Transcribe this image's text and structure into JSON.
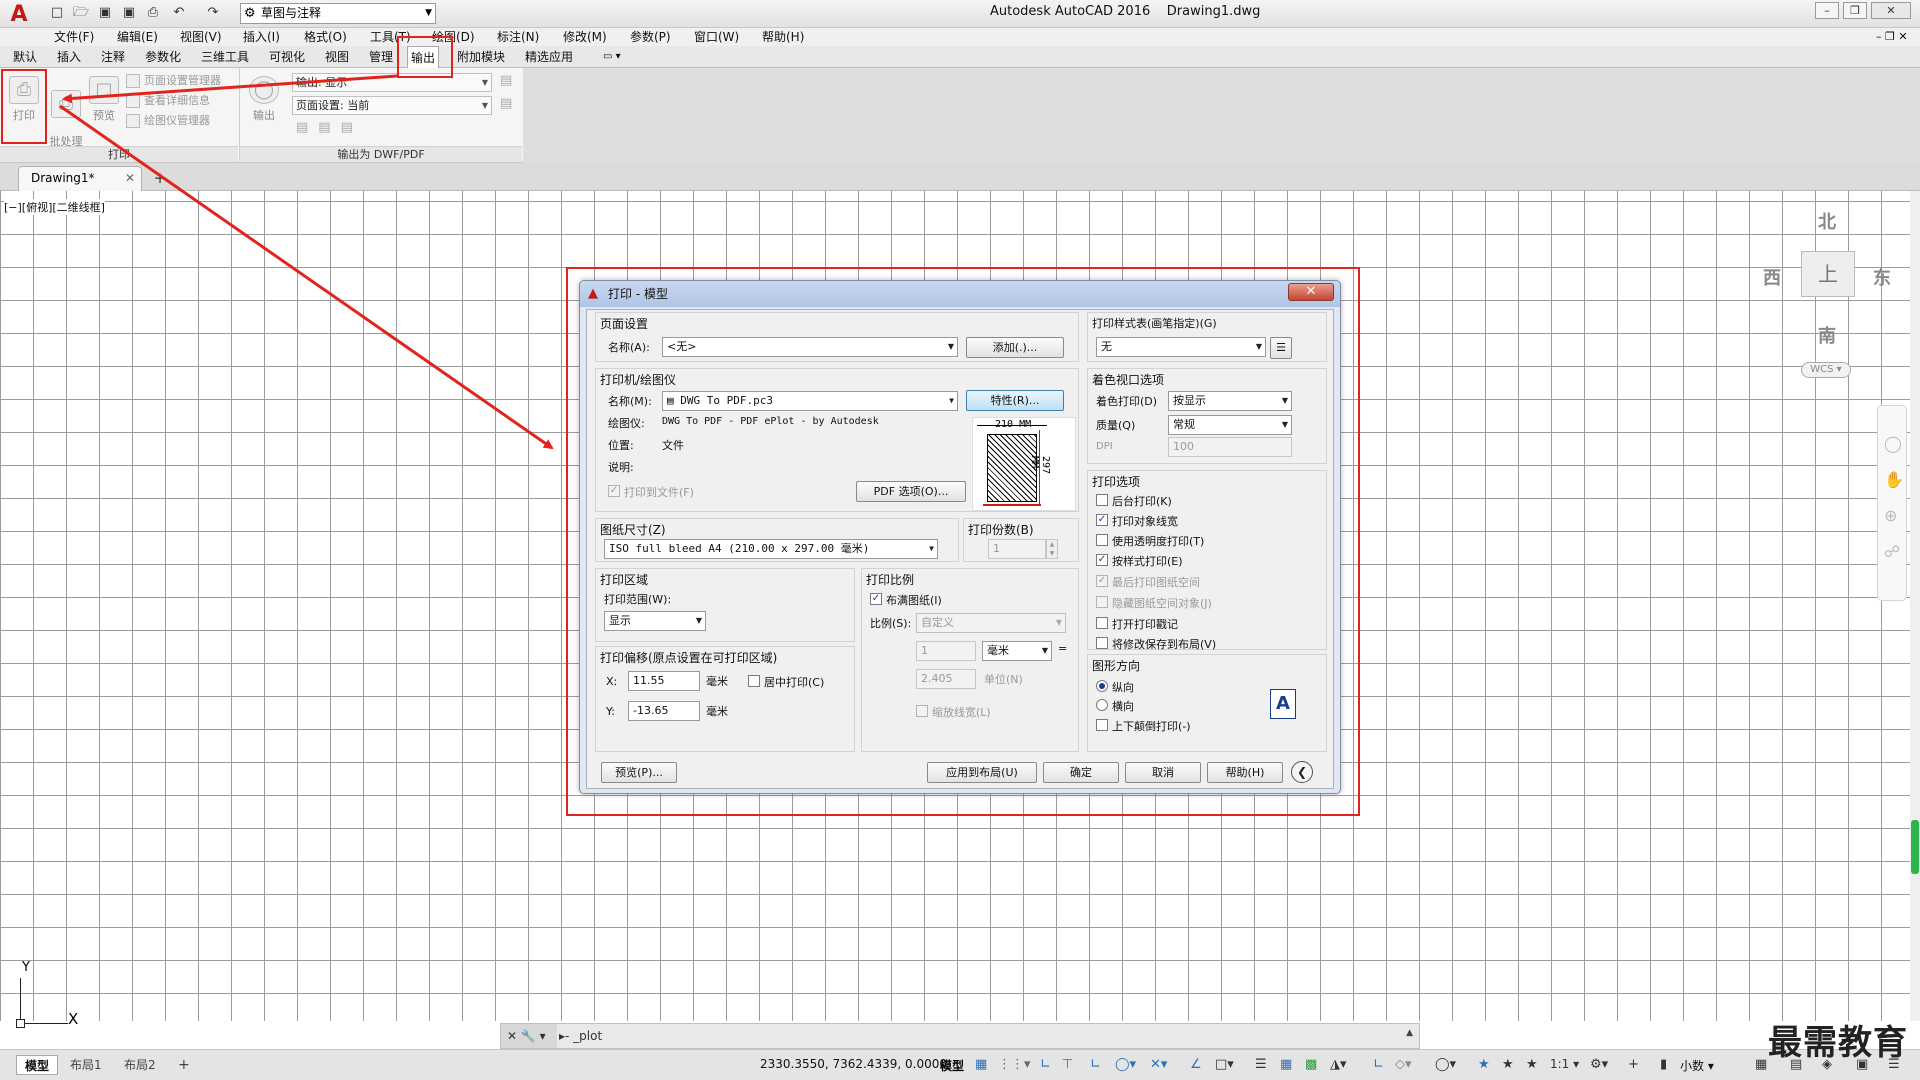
{
  "app": {
    "title": "Autodesk AutoCAD 2016",
    "file": "Drawing1.dwg",
    "logo_icon": "autocad-a-icon",
    "workspace": "草图与注释"
  },
  "menubar": [
    "文件(F)",
    "编辑(E)",
    "视图(V)",
    "插入(I)",
    "格式(O)",
    "工具(T)",
    "绘图(D)",
    "标注(N)",
    "修改(M)",
    "参数(P)",
    "窗口(W)",
    "帮助(H)"
  ],
  "ribbon_tabs": [
    "默认",
    "插入",
    "注释",
    "参数化",
    "三维工具",
    "可视化",
    "视图",
    "管理",
    "输出",
    "附加模块",
    "精选应用"
  ],
  "ribbon_active_tab": "输出",
  "ribbon": {
    "plot_label": "打印",
    "batch_label": "批处理\n打印",
    "preview_label": "预览",
    "page_setup_manager": "页面设置管理器",
    "view_details": "查看详细信息",
    "plotter_manager": "绘图仪管理器",
    "plot_panel": "打印",
    "export_label": "输出",
    "export_combo": "输出: 显示",
    "page_setup_combo": "页面设置: 当前",
    "export_panel": "输出为 DWF/PDF"
  },
  "doc_tab": "Drawing1*",
  "viewport_control": "[−][俯视][二维线框]",
  "viewcube": {
    "n": "北",
    "s": "南",
    "e": "东",
    "w": "西",
    "top": "上",
    "wcs": "WCS"
  },
  "ucs": {
    "x": "X",
    "y": "Y"
  },
  "command": {
    "prompt": "_plot"
  },
  "layout_tabs": [
    "模型",
    "布局1",
    "布局2"
  ],
  "status": {
    "coords": "2330.3550, 7362.4339, 0.0000",
    "mode": "模型",
    "scale": "1:1",
    "units": "小数"
  },
  "brand_watermark": "最需教育",
  "dialog": {
    "title": "打印 - 模型",
    "page_setup": {
      "group": "页面设置",
      "name_label": "名称(A):",
      "name_value": "<无>",
      "add_button": "添加(.)..."
    },
    "printer": {
      "group": "打印机/绘图仪",
      "name_label": "名称(M):",
      "name_value": "DWG To PDF.pc3",
      "properties_button": "特性(R)...",
      "plotter_label": "绘图仪:",
      "plotter_value": "DWG To PDF - PDF ePlot - by Autodesk",
      "location_label": "位置:",
      "location_value": "文件",
      "description_label": "说明:",
      "plot_to_file": "打印到文件(F)",
      "pdf_options_button": "PDF 选项(O)...",
      "paper_width": "210 MM",
      "paper_height": "297 MM"
    },
    "paper_size": {
      "group": "图纸尺寸(Z)",
      "value": "ISO full bleed A4 (210.00 x 297.00 毫米)"
    },
    "copies": {
      "group": "打印份数(B)",
      "value": "1"
    },
    "plot_area": {
      "group": "打印区域",
      "range_label": "打印范围(W):",
      "range_value": "显示"
    },
    "plot_scale": {
      "group": "打印比例",
      "fit_to_paper": "布满图纸(I)",
      "scale_label": "比例(S):",
      "scale_value": "自定义",
      "value1": "1",
      "unit": "毫米",
      "equals": "=",
      "value2": "2.405",
      "unit2": "单位(N)",
      "scale_lineweights": "缩放线宽(L)"
    },
    "plot_offset": {
      "group": "打印偏移(原点设置在可打印区域)",
      "x_label": "X:",
      "x_value": "11.55",
      "y_label": "Y:",
      "y_value": "-13.65",
      "unit": "毫米",
      "center": "居中打印(C)"
    },
    "style_table": {
      "group": "打印样式表(画笔指定)(G)",
      "value": "无"
    },
    "shaded_viewport": {
      "group": "着色视口选项",
      "shade_label": "着色打印(D)",
      "shade_value": "按显示",
      "quality_label": "质量(Q)",
      "quality_value": "常规",
      "dpi_label": "DPI",
      "dpi_value": "100"
    },
    "plot_options": {
      "group": "打印选项",
      "items": [
        {
          "label": "后台打印(K)",
          "checked": false,
          "disabled": false
        },
        {
          "label": "打印对象线宽",
          "checked": true,
          "disabled": false
        },
        {
          "label": "使用透明度打印(T)",
          "checked": false,
          "disabled": false
        },
        {
          "label": "按样式打印(E)",
          "checked": true,
          "disabled": false
        },
        {
          "label": "最后打印图纸空间",
          "checked": true,
          "disabled": true
        },
        {
          "label": "隐藏图纸空间对象(J)",
          "checked": false,
          "disabled": true
        },
        {
          "label": "打开打印戳记",
          "checked": false,
          "disabled": false
        },
        {
          "label": "将修改保存到布局(V)",
          "checked": false,
          "disabled": false
        }
      ]
    },
    "orientation": {
      "group": "图形方向",
      "portrait": "纵向",
      "landscape": "横向",
      "upside_down": "上下颠倒打印(-)",
      "icon_letter": "A"
    },
    "buttons": {
      "preview": "预览(P)...",
      "apply": "应用到布局(U)",
      "ok": "确定",
      "cancel": "取消",
      "help": "帮助(H)"
    }
  }
}
